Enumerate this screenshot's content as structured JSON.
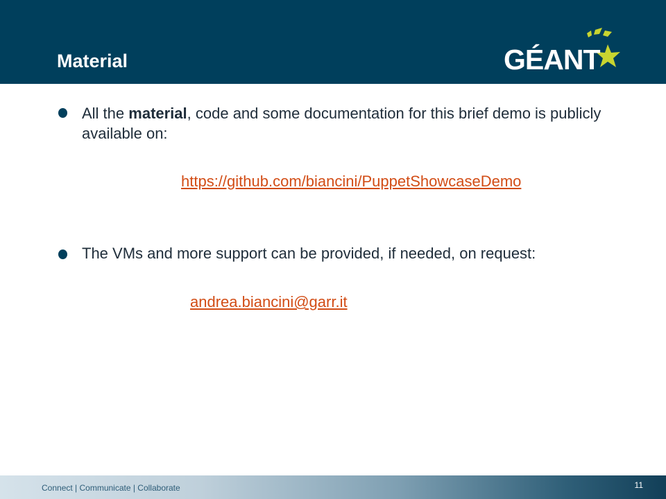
{
  "slide": {
    "title": "Material",
    "logo_text": "GÉANT",
    "bullets": [
      {
        "before_bold": "All the ",
        "bold": "material",
        "after_bold": ", code and some documentation for this brief demo is publicly available on:",
        "link": "https://github.com/biancini/PuppetShowcaseDemo"
      },
      {
        "text": "The VMs and more support can be provided, if needed, on request:",
        "link": "andrea.biancini@garr.it"
      }
    ],
    "footer": {
      "tagline": "Connect | Communicate | Collaborate",
      "page_number": "11"
    }
  },
  "colors": {
    "header": "#003f5c",
    "link": "#d24d16",
    "logo_star": "#c8d530"
  },
  "icons": {
    "logo": "geant-star-logo"
  }
}
